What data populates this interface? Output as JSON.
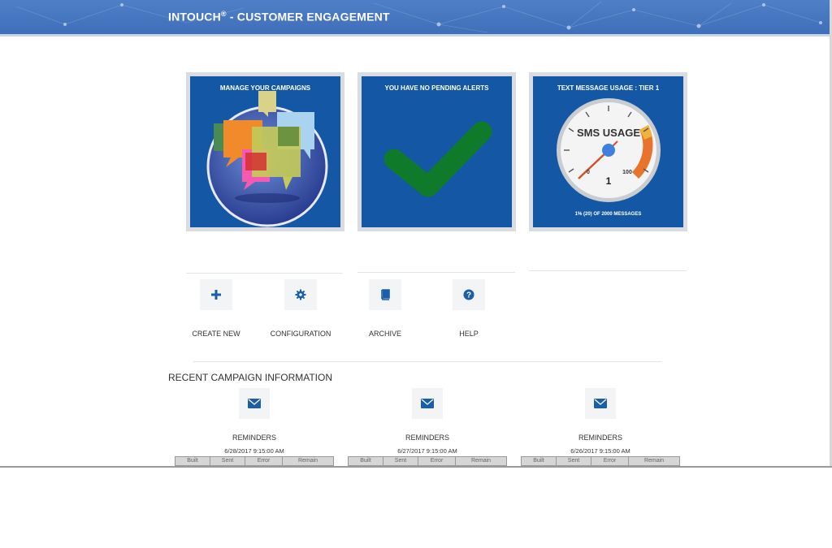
{
  "header": {
    "title": "INTOUCH",
    "reg": "®",
    "subtitle": " - CUSTOMER ENGAGEMENT"
  },
  "tiles": [
    {
      "title": "MANAGE YOUR CAMPAIGNS",
      "icon": "speech-bubbles-globe-icon"
    },
    {
      "title": "YOU HAVE NO PENDING ALERTS",
      "icon": "checkmark-icon"
    },
    {
      "title": "TEXT MESSAGE USAGE : TIER 1",
      "icon": "sms-gauge-icon",
      "gauge": {
        "label": "SMS USAGE",
        "min": "0",
        "max": "100",
        "value": "1"
      },
      "footer": "1% (20) OF 2000 MESSAGES"
    }
  ],
  "actions": [
    {
      "label": "CREATE NEW",
      "icon": "plus-icon"
    },
    {
      "label": "CONFIGURATION",
      "icon": "gear-icon"
    },
    {
      "label": "ARCHIVE",
      "icon": "book-icon"
    },
    {
      "label": "HELP",
      "icon": "question-icon"
    }
  ],
  "recent": {
    "title": "RECENT CAMPAIGN INFORMATION",
    "columns": [
      "Built",
      "Sent",
      "Error",
      "Remain"
    ],
    "campaigns": [
      {
        "name": "REMINDERS",
        "date": "6/28/2017 9:15:00 AM",
        "icon": "envelope-icon"
      },
      {
        "name": "REMINDERS",
        "date": "6/27/2017 9:15:00 AM",
        "icon": "envelope-icon"
      },
      {
        "name": "REMINDERS",
        "date": "6/26/2017 9:15:00 AM",
        "icon": "envelope-icon"
      }
    ]
  },
  "colors": {
    "header": "#4676c0",
    "tile": "#1457a4",
    "check": "#0f7a2a",
    "icon": "#1a5fa8"
  }
}
